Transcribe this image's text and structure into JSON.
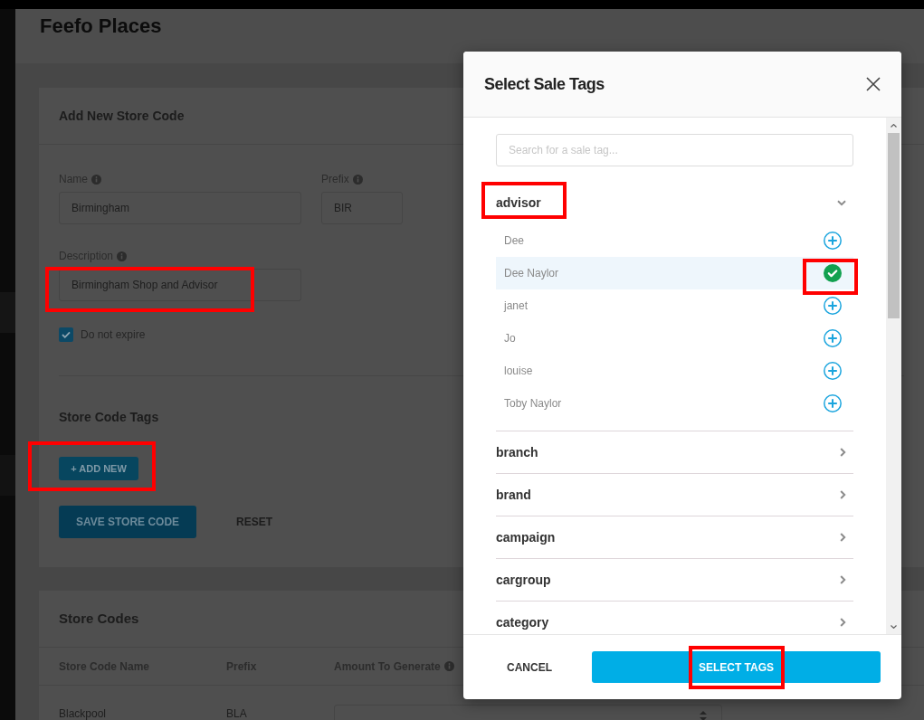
{
  "page": {
    "title": "Feefo Places"
  },
  "add_store_code": {
    "heading": "Add New Store Code",
    "fields": [
      {
        "label": "Name",
        "value": "Birmingham",
        "highlighted": false
      },
      {
        "label": "Prefix",
        "value": "BIR",
        "highlighted": false
      },
      {
        "label": "Description",
        "value": "Birmingham Shop and Advisor",
        "highlighted": true
      }
    ],
    "no_expiry": {
      "label": "Do not expire",
      "checked": true
    },
    "tags_heading": "Store Code Tags",
    "add_new": {
      "label": "+ ADD NEW",
      "highlighted": true
    },
    "actions": [
      {
        "label": "SAVE STORE CODE",
        "kind": "primary"
      },
      {
        "label": "RESET",
        "kind": "text"
      }
    ]
  },
  "store_codes": {
    "heading": "Store Codes",
    "columns": [
      {
        "label": "Store Code Name",
        "has_info": false
      },
      {
        "label": "Prefix",
        "has_info": false
      },
      {
        "label": "Amount To Generate",
        "has_info": true
      }
    ],
    "rows": [
      {
        "name": "Blackpool",
        "prefix": "BLA"
      }
    ]
  },
  "modal": {
    "title": "Select Sale Tags",
    "search": {
      "placeholder": "Search for a sale tag..."
    },
    "groups": [
      {
        "label": "advisor",
        "expanded": true,
        "highlighted": true,
        "children": [
          {
            "label": "Dee",
            "selected": false,
            "highlighted": false
          },
          {
            "label": "Dee Naylor",
            "selected": true,
            "highlighted": true
          },
          {
            "label": "janet",
            "selected": false,
            "highlighted": false
          },
          {
            "label": "Jo",
            "selected": false,
            "highlighted": false
          },
          {
            "label": "louise",
            "selected": false,
            "highlighted": false
          },
          {
            "label": "Toby Naylor",
            "selected": false,
            "highlighted": false
          }
        ]
      },
      {
        "label": "branch",
        "expanded": false,
        "highlighted": false
      },
      {
        "label": "brand",
        "expanded": false,
        "highlighted": false
      },
      {
        "label": "campaign",
        "expanded": false,
        "highlighted": false
      },
      {
        "label": "cargroup",
        "expanded": false,
        "highlighted": false
      },
      {
        "label": "category",
        "expanded": false,
        "highlighted": false
      }
    ],
    "buttons": [
      {
        "label": "CANCEL",
        "kind": "text",
        "highlighted": false
      },
      {
        "label": "SELECT TAGS",
        "kind": "primary",
        "highlighted": true
      }
    ]
  }
}
